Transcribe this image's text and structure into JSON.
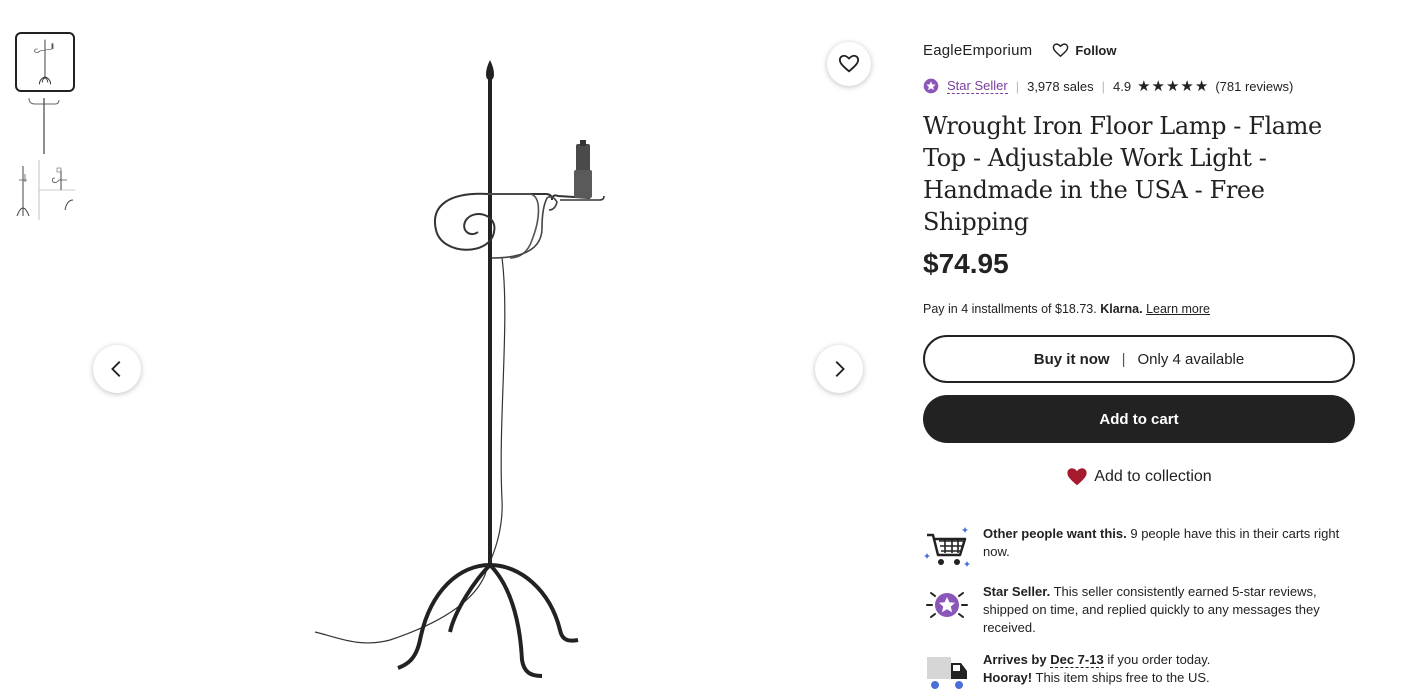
{
  "gallery": {
    "thumbnail_count": 3,
    "favorite_icon": "heart-outline-icon",
    "prev_icon": "chevron-left-icon",
    "next_icon": "chevron-right-icon"
  },
  "shop": {
    "name": "EagleEmporium",
    "follow_label": "Follow"
  },
  "meta": {
    "star_seller_label": "Star Seller",
    "sales": "3,978 sales",
    "rating": "4.9",
    "rating_stars": 5,
    "reviews": "(781 reviews)"
  },
  "listing": {
    "title": "Wrought Iron Floor Lamp - Flame Top - Adjustable Work Light - Handmade in the USA - Free Shipping",
    "price": "$74.95"
  },
  "klarna": {
    "prefix": "Pay in 4 installments of $18.73.",
    "brand": "Klarna.",
    "learn_more": "Learn more"
  },
  "actions": {
    "buy_now": "Buy it now",
    "separator": "|",
    "availability": "Only 4 available",
    "add_to_cart": "Add to cart",
    "add_to_collection": "Add to collection"
  },
  "features": {
    "carts_title": "Other people want this.",
    "carts_text": " 9 people have this in their carts right now.",
    "star_title": "Star Seller.",
    "star_text": " This seller consistently earned 5-star reviews, shipped on time, and replied quickly to any messages they received.",
    "arrives_prefix": "Arrives by",
    "arrives_date": "Dec 7-13",
    "arrives_suffix": " if you order today.",
    "hooray_title": "Hooray!",
    "hooray_text": " This item ships free to the US."
  },
  "colors": {
    "text": "#222222",
    "star_seller_purple": "#7a3fa0",
    "heart_red": "#a61a2e",
    "shipping_blue": "#4a6fd8"
  }
}
